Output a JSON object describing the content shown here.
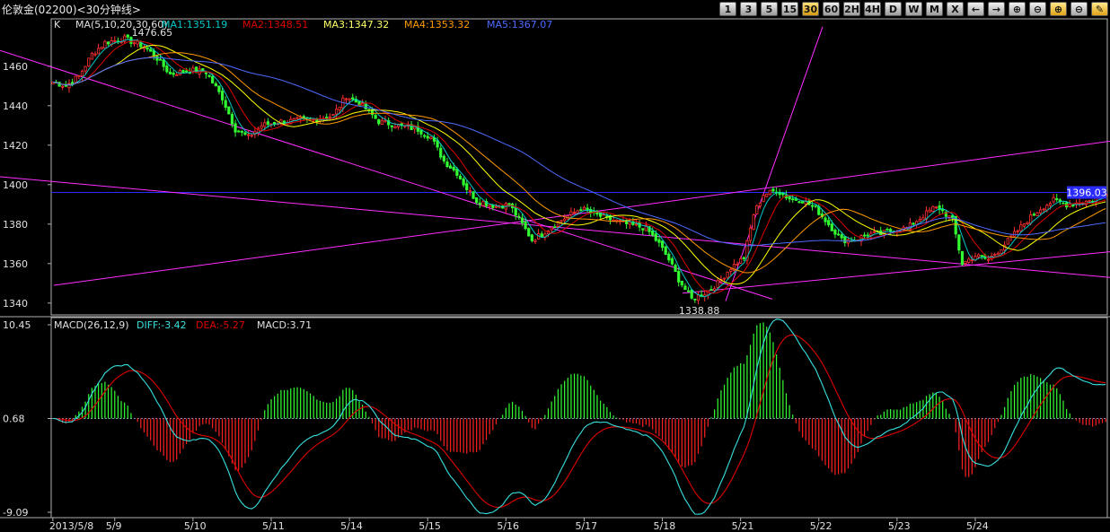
{
  "window": {
    "title": "伦敦金(02200)<30分钟线>"
  },
  "toolbar": {
    "buttons": [
      {
        "label": "1",
        "kind": "period"
      },
      {
        "label": "3",
        "kind": "period"
      },
      {
        "label": "5",
        "kind": "period"
      },
      {
        "label": "15",
        "kind": "period"
      },
      {
        "label": "30",
        "kind": "period",
        "active": true
      },
      {
        "label": "60",
        "kind": "period"
      },
      {
        "label": "2H",
        "kind": "period"
      },
      {
        "label": "4H",
        "kind": "period"
      },
      {
        "label": "D",
        "kind": "period"
      },
      {
        "label": "W",
        "kind": "period"
      },
      {
        "label": "M",
        "kind": "period"
      },
      {
        "label": "X",
        "kind": "period"
      },
      {
        "icon": "arrow-left-icon",
        "kind": "icon"
      },
      {
        "icon": "arrow-right-icon",
        "kind": "icon"
      },
      {
        "icon": "zoom-in-icon",
        "kind": "icon"
      },
      {
        "icon": "zoom-out-icon",
        "kind": "icon"
      },
      {
        "icon": "zoom-in-highlight-icon",
        "kind": "icon",
        "hl": true
      },
      {
        "icon": "zoom-out-alt-icon",
        "kind": "icon"
      },
      {
        "icon": "settings-highlight-icon",
        "kind": "icon",
        "hl": true
      }
    ]
  },
  "chart_data": [
    {
      "type": "candlestick",
      "panel": "price",
      "legend": {
        "k": "K",
        "ma_params": "MA(5,10,20,30,60)",
        "ma1": "MA1:1351.19",
        "ma2": "MA2:1348.51",
        "ma3": "MA3:1347.32",
        "ma4": "MA4:1353.32",
        "ma5": "MA5:1367.07"
      },
      "colors": {
        "ma1": "#00c8c8",
        "ma2": "#e00000",
        "ma3": "#ffff00",
        "ma4": "#ff9900",
        "ma5": "#4d6bff",
        "up": "#ff3030",
        "down": "#32ff32",
        "trend": "#ff2eff",
        "current": "#2b2bff"
      },
      "yticks": [
        "1460",
        "1440",
        "1420",
        "1400",
        "1380",
        "1360",
        "1340"
      ],
      "ylim": [
        1334,
        1484
      ],
      "high_label": "1476.65",
      "low_label": "1338.88",
      "last_price_label": "1396.03",
      "last_price": 1396.03,
      "anchors": [
        [
          0,
          1452
        ],
        [
          4,
          1450
        ],
        [
          8,
          1455
        ],
        [
          12,
          1466
        ],
        [
          16,
          1472
        ],
        [
          22,
          1474
        ],
        [
          28,
          1470
        ],
        [
          32,
          1464
        ],
        [
          36,
          1456
        ],
        [
          42,
          1458
        ],
        [
          47,
          1457
        ],
        [
          52,
          1444
        ],
        [
          56,
          1428
        ],
        [
          60,
          1424
        ],
        [
          64,
          1430
        ],
        [
          70,
          1432
        ],
        [
          80,
          1433
        ],
        [
          86,
          1435
        ],
        [
          90,
          1445
        ],
        [
          95,
          1440
        ],
        [
          100,
          1432
        ],
        [
          106,
          1430
        ],
        [
          112,
          1428
        ],
        [
          116,
          1424
        ],
        [
          120,
          1412
        ],
        [
          124,
          1406
        ],
        [
          127,
          1398
        ],
        [
          130,
          1392
        ],
        [
          136,
          1389
        ],
        [
          140,
          1390
        ],
        [
          144,
          1380
        ],
        [
          147,
          1372
        ],
        [
          150,
          1375
        ],
        [
          154,
          1380
        ],
        [
          158,
          1384
        ],
        [
          162,
          1388
        ],
        [
          166,
          1385
        ],
        [
          170,
          1383
        ],
        [
          176,
          1380
        ],
        [
          182,
          1378
        ],
        [
          186,
          1370
        ],
        [
          189,
          1362
        ],
        [
          192,
          1352
        ],
        [
          196,
          1342
        ],
        [
          200,
          1345
        ],
        [
          204,
          1350
        ],
        [
          208,
          1358
        ],
        [
          212,
          1363
        ],
        [
          215,
          1385
        ],
        [
          218,
          1395
        ],
        [
          222,
          1397
        ],
        [
          226,
          1393
        ],
        [
          230,
          1392
        ],
        [
          234,
          1388
        ],
        [
          238,
          1380
        ],
        [
          242,
          1372
        ],
        [
          246,
          1372
        ],
        [
          250,
          1375
        ],
        [
          254,
          1375
        ],
        [
          258,
          1377
        ],
        [
          262,
          1378
        ],
        [
          266,
          1383
        ],
        [
          270,
          1388
        ],
        [
          272,
          1388
        ],
        [
          276,
          1382
        ],
        [
          279,
          1360
        ],
        [
          283,
          1364
        ],
        [
          287,
          1362
        ],
        [
          291,
          1368
        ],
        [
          295,
          1375
        ],
        [
          299,
          1382
        ],
        [
          303,
          1388
        ],
        [
          307,
          1392
        ],
        [
          311,
          1390
        ],
        [
          315,
          1391
        ],
        [
          319,
          1392
        ],
        [
          323,
          1395
        ]
      ],
      "xticks": [
        {
          "label": "2013/5/8",
          "i": 0
        },
        {
          "label": "5/9",
          "i": 19
        },
        {
          "label": "5/10",
          "i": 43
        },
        {
          "label": "5/11",
          "i": 67
        },
        {
          "label": "5/14",
          "i": 91
        },
        {
          "label": "5/15",
          "i": 115
        },
        {
          "label": "5/16",
          "i": 139
        },
        {
          "label": "5/17",
          "i": 163
        },
        {
          "label": "5/18",
          "i": 187
        },
        {
          "label": "5/21",
          "i": 211
        },
        {
          "label": "5/22",
          "i": 235
        },
        {
          "label": "5/23",
          "i": 259
        },
        {
          "label": "5/24",
          "i": 283
        }
      ]
    },
    {
      "type": "macd",
      "panel": "indicator",
      "legend": {
        "params": "MACD(26,12,9)",
        "diff": "DIFF:-3.42",
        "dea": "DEA:-5.27",
        "macd": "MACD:3.71"
      },
      "yticks": [
        "10.45",
        "0.68",
        "-9.09"
      ],
      "ylim": [
        -9.09,
        10.45
      ],
      "zero": 0.68,
      "colors": {
        "diff": "#36e0e0",
        "dea": "#e00000",
        "pos": "#33ff33",
        "neg": "#ff2020",
        "grid": "#8888bb"
      }
    }
  ]
}
